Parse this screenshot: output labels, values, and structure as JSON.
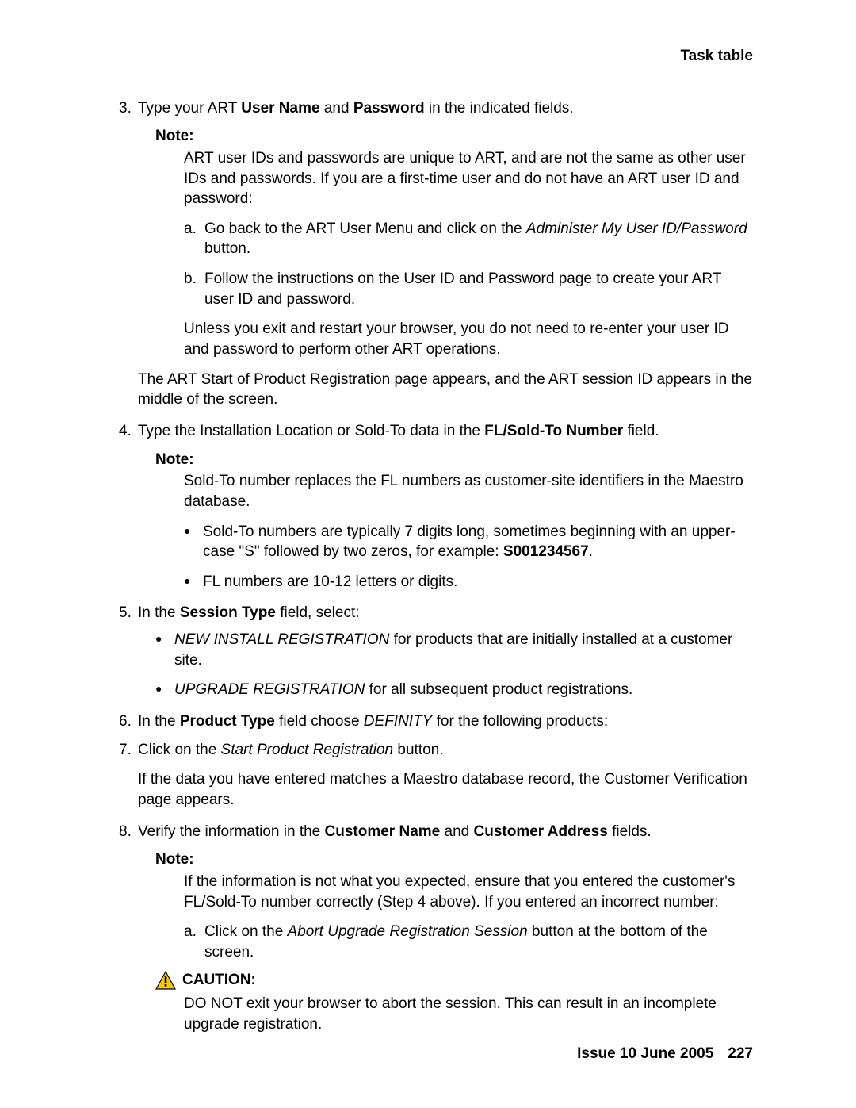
{
  "header": {
    "title": "Task table"
  },
  "step3": {
    "num": "3.",
    "line_a": "Type your ART ",
    "bold_a": "User Name",
    "line_b": " and ",
    "bold_b": "Password",
    "line_c": " in the indicated fields."
  },
  "note1": {
    "label": "Note:",
    "body": "ART user IDs and passwords are unique to ART, and are not the same as other user IDs and passwords. If you are a first-time user and do not have an ART user ID and password:"
  },
  "sub_a": {
    "letter": "a.",
    "pre": "Go back to the ART User Menu and click on the ",
    "italic": "Administer My User ID/Password",
    "post": " button."
  },
  "sub_b": {
    "letter": "b.",
    "text": "Follow the instructions on the User ID and Password page to create your ART user ID and password."
  },
  "note1_para2": "Unless you exit and restart your browser, you do not need to re-enter your user ID and password to perform other ART operations.",
  "step3_result": "The ART Start of Product Registration page appears, and the ART session ID appears in the middle of the screen.",
  "step4": {
    "num": "4.",
    "pre": "Type the Installation Location or Sold-To data in the ",
    "bold": "FL/Sold-To Number",
    "post": " field."
  },
  "note2": {
    "label": "Note:",
    "body": "Sold-To number replaces the FL numbers as customer-site identifiers in the Maestro database."
  },
  "bullet_s4a": {
    "pre": "Sold-To numbers are typically 7 digits long, sometimes beginning with an upper-case \"S\" followed by two zeros, for example: ",
    "bold": "S001234567",
    "post": "."
  },
  "bullet_s4b": "FL numbers are 10-12 letters or digits.",
  "step5": {
    "num": "5.",
    "pre": "In the ",
    "bold": "Session Type",
    "post": " field, select:"
  },
  "bullet_s5a": {
    "italic": "NEW INSTALL REGISTRATION",
    "post": " for products that are initially installed at a customer site."
  },
  "bullet_s5b": {
    "italic": "UPGRADE REGISTRATION",
    "post": " for all subsequent product registrations."
  },
  "step6": {
    "num": "6.",
    "pre": "In the ",
    "bold": "Product Type",
    "mid": " field choose ",
    "italic": "DEFINITY",
    "post": " for the following products:"
  },
  "step7": {
    "num": "7.",
    "pre": "Click on the ",
    "italic": "Start Product Registration",
    "post": " button."
  },
  "step7_result": "If the data you have entered matches a Maestro database record, the Customer Verification page appears.",
  "step8": {
    "num": "8.",
    "pre": "Verify the information in the ",
    "bold_a": "Customer Name",
    "mid": " and ",
    "bold_b": "Customer Address",
    "post": " fields."
  },
  "note3": {
    "label": "Note:",
    "body": "If the information is not what you expected, ensure that you entered the customer's FL/Sold-To number correctly (Step 4 above). If you entered an incorrect number:"
  },
  "sub3a": {
    "letter": "a.",
    "pre": "Click on the ",
    "italic": "Abort Upgrade Registration Session",
    "post": " button at the bottom of the screen."
  },
  "caution": {
    "label": "CAUTION:",
    "body": "DO NOT exit your browser to abort the session. This can result in an incomplete upgrade registration."
  },
  "footer": {
    "issue": "Issue 10   June 2005",
    "page": "227"
  }
}
